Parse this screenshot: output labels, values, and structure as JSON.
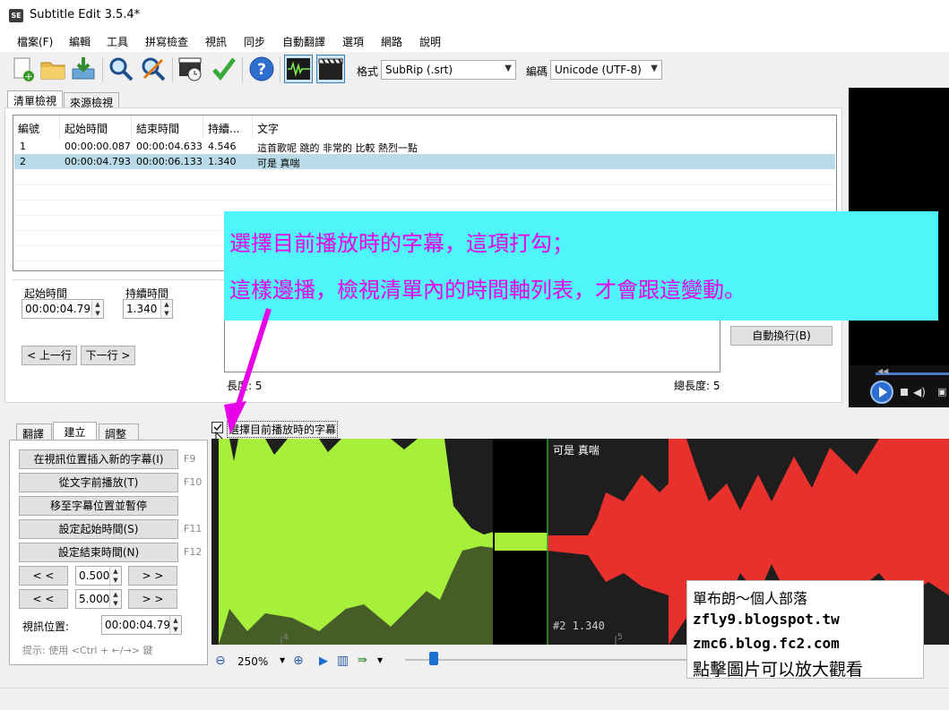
{
  "window": {
    "title": "Subtitle Edit 3.5.4*",
    "icon_text": "SE"
  },
  "menu": [
    "檔案(F)",
    "編輯",
    "工具",
    "拼寫檢查",
    "視訊",
    "同步",
    "自動翻譯",
    "選項",
    "網路",
    "說明"
  ],
  "toolbar": {
    "icons": [
      "new-file-icon",
      "open-folder-icon",
      "save-download-icon",
      "find-icon",
      "replace-icon",
      "video-sync-icon",
      "spell-check-icon",
      "help-icon",
      "waveform-toggle-icon",
      "video-toggle-icon"
    ],
    "format_label": "格式",
    "format_value": "SubRip (.srt)",
    "encoding_label": "編碼",
    "encoding_value": "Unicode (UTF-8)"
  },
  "tabs": {
    "list_view": "清單檢視",
    "source_view": "來源檢視"
  },
  "subtitle_list": {
    "columns": [
      "編號",
      "起始時間",
      "結束時間",
      "持續...",
      "文字"
    ],
    "rows": [
      {
        "num": "1",
        "start": "00:00:00.087",
        "end": "00:00:04.633",
        "duration": "4.546",
        "text": "這首歌呢 跳的 非常的 比較 熱烈一點"
      },
      {
        "num": "2",
        "start": "00:00:04.793",
        "end": "00:00:06.133",
        "duration": "1.340",
        "text": "可是 真喘"
      }
    ],
    "selected_row": 2
  },
  "edit": {
    "start_label": "起始時間",
    "start_value": "00:00:04.793",
    "duration_label": "持續時間",
    "duration_value": "1.340",
    "prev_button": "< 上一行",
    "next_button": "下一行 >",
    "auto_break_button": "自動換行(B)",
    "length_left": "長度: 5",
    "length_total": "總長度: 5"
  },
  "bottom_tabs": [
    "翻譯",
    "建立",
    "調整"
  ],
  "create_panel": {
    "buttons": [
      {
        "label": "在視訊位置插入新的字幕(I)",
        "shortcut": "F9"
      },
      {
        "label": "從文字前播放(T)",
        "shortcut": "F10"
      },
      {
        "label": "移至字幕位置並暫停",
        "shortcut": ""
      },
      {
        "label": "設定起始時間(S)",
        "shortcut": "F11"
      },
      {
        "label": "設定結束時間(N)",
        "shortcut": "F12"
      }
    ],
    "step_small": "0.500",
    "step_large": "5.000",
    "back_label": "< <",
    "forward_label": "> >",
    "video_position_label": "視訊位置:",
    "video_position_value": "00:00:04.793",
    "hint": "提示: 使用 <Ctrl + ←/→> 鍵"
  },
  "select_current_checkbox": {
    "label": "選擇目前播放時的字幕",
    "checked": true
  },
  "waveform": {
    "subtitle_text": "可是 真喘",
    "subtitle_info": "#2  1.340",
    "marker_4": "4",
    "marker_5": "5",
    "colors": {
      "played": "#a6f03c",
      "selected": "#e8302c",
      "background": "#1e1e1e",
      "gap": "#000000"
    }
  },
  "wave_toolbar": {
    "zoom": "250%"
  },
  "annotation": {
    "line1": "選擇目前播放時的字幕，這項打勾；",
    "line2": "這樣邊播，檢視清單內的時間軸列表，才會跟這變動。",
    "text_color": "#e800e8",
    "bg_color": "#50f5f9"
  },
  "blog_box": {
    "line1": "單布朗～個人部落",
    "line2": "zfly9.blogspot.tw",
    "line3": "zmc6.blog.fc2.com",
    "line4": "點擊圖片可以放大觀看"
  }
}
